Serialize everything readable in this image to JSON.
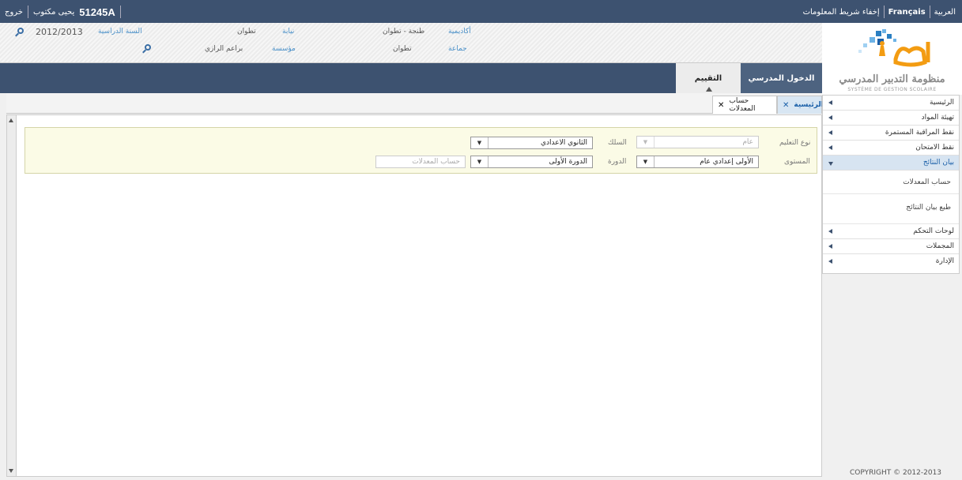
{
  "topbar": {
    "logout": "خروج",
    "user_name": "يحيى مكتوب",
    "user_code": "51245A",
    "lang_ar": "العربية",
    "lang_fr": "Français",
    "hide_info": "إخفاء شريط المعلومات"
  },
  "info": {
    "academy_label": "أكاديمية",
    "academy_value": "طنجة - تطوان",
    "province_label": "نيابة",
    "province_value": "تطوان",
    "year_label": "السنة الدراسية",
    "year_value": "2012/2013",
    "commune_label": "جماعة",
    "commune_value": "تطوان",
    "school_label": "مؤسسة",
    "school_value": "براعم الرازي"
  },
  "logo": {
    "title": "منظومة التدبير المدرسي",
    "subtitle": "SYSTÈME DE GESTION SCOLAIRE"
  },
  "navbar": {
    "tabs": [
      {
        "label": "التقييم"
      },
      {
        "label": "الدخول المدرسي"
      }
    ]
  },
  "tabs": {
    "home": "الرئيسية",
    "current": "حساب المعدلات"
  },
  "filters": {
    "education_type_label": "نوع التعليم",
    "education_type_value": "عام",
    "cycle_label": "السلك",
    "cycle_value": "الثانوي الاعدادي",
    "level_label": "المستوى",
    "level_value": "الأولى إعدادي عام",
    "session_label": "الدورة",
    "session_value": "الدورة الأولى",
    "compute_button": "حساب المعدلات"
  },
  "sidebar": {
    "items": [
      {
        "label": "الرئيسية"
      },
      {
        "label": "تهيئة المواد"
      },
      {
        "label": "نقط المراقبة المستمرة"
      },
      {
        "label": "نقط الامتحان"
      },
      {
        "label": "بيان النتائج"
      },
      {
        "label": "لوحات التحكم"
      },
      {
        "label": "المجملات"
      },
      {
        "label": "الإدارة"
      }
    ],
    "subitems": [
      {
        "label": "حساب المعدلات"
      },
      {
        "label": "طبع بيان النتائج"
      }
    ]
  },
  "footer": {
    "copyright": "COPYRIGHT © 2012-2013"
  }
}
